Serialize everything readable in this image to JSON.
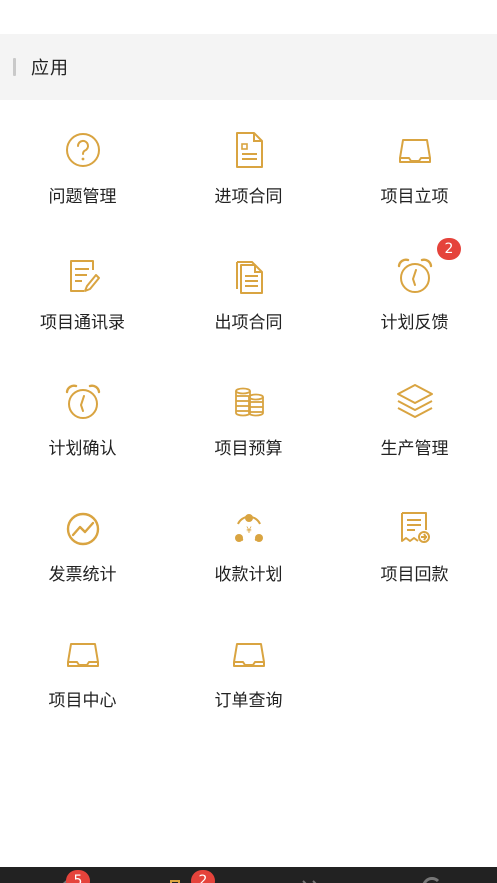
{
  "section": {
    "title": "应用"
  },
  "apps": [
    {
      "label": "问题管理",
      "icon": "question-icon"
    },
    {
      "label": "进项合同",
      "icon": "document-icon"
    },
    {
      "label": "项目立项",
      "icon": "inbox-tray-icon"
    },
    {
      "label": "项目通讯录",
      "icon": "edit-document-icon"
    },
    {
      "label": "出项合同",
      "icon": "stacked-documents-icon"
    },
    {
      "label": "计划反馈",
      "icon": "alarm-clock-icon",
      "badge": "2"
    },
    {
      "label": "计划确认",
      "icon": "alarm-clock-icon"
    },
    {
      "label": "项目预算",
      "icon": "coins-icon"
    },
    {
      "label": "生产管理",
      "icon": "layers-icon"
    },
    {
      "label": "发票统计",
      "icon": "trend-chart-icon"
    },
    {
      "label": "收款计划",
      "icon": "money-cycle-icon"
    },
    {
      "label": "项目回款",
      "icon": "receipt-icon"
    },
    {
      "label": "项目中心",
      "icon": "inbox-tray-icon"
    },
    {
      "label": "订单查询",
      "icon": "inbox-tray-icon"
    }
  ],
  "tabbar": {
    "badges": [
      "5",
      "2"
    ]
  },
  "colors": {
    "accent": "#d9a441",
    "badge": "#e5433b"
  }
}
